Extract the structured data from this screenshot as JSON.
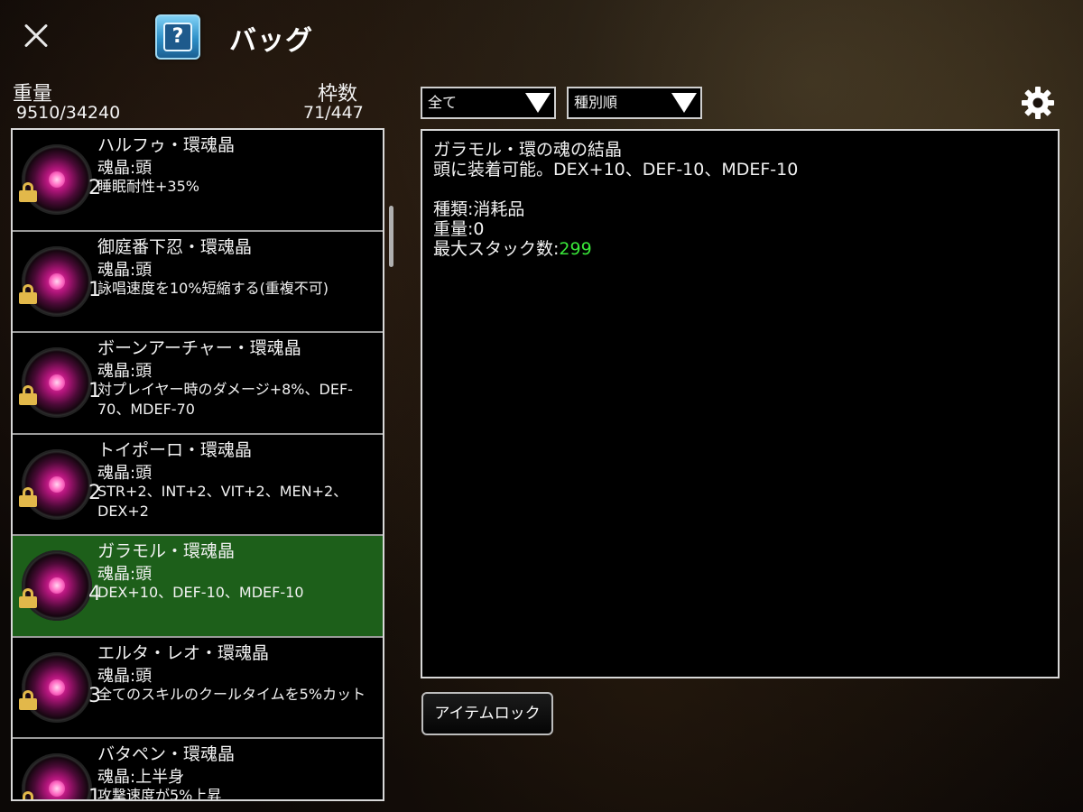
{
  "header": {
    "title": "バッグ",
    "help_glyph": "?",
    "close_icon": "close-icon",
    "settings_icon": "gear-icon"
  },
  "stats": {
    "weight_label": "重量",
    "weight_value": "9510/34240",
    "slots_label": "枠数",
    "slots_value": "71/447"
  },
  "filters": {
    "category": "全て",
    "sort": "種別順"
  },
  "items": [
    {
      "name": "ハルフゥ・環魂晶",
      "slot": "魂晶:頭",
      "qty": "2",
      "effect": "睡眠耐性+35%",
      "locked": true,
      "selected": false
    },
    {
      "name": "御庭番下忍・環魂晶",
      "slot": "魂晶:頭",
      "qty": "1",
      "effect": "詠唱速度を10%短縮する(重複不可)",
      "locked": true,
      "selected": false
    },
    {
      "name": "ボーンアーチャー・環魂晶",
      "slot": "魂晶:頭",
      "qty": "1",
      "effect": "対プレイヤー時のダメージ+8%、DEF-70、MDEF-70",
      "locked": true,
      "selected": false
    },
    {
      "name": "トイポーロ・環魂晶",
      "slot": "魂晶:頭",
      "qty": "2",
      "effect": "STR+2、INT+2、VIT+2、MEN+2、DEX+2",
      "locked": true,
      "selected": false
    },
    {
      "name": "ガラモル・環魂晶",
      "slot": "魂晶:頭",
      "qty": "4",
      "effect": "DEX+10、DEF-10、MDEF-10",
      "locked": true,
      "selected": true
    },
    {
      "name": "エルタ・レオ・環魂晶",
      "slot": "魂晶:頭",
      "qty": "3",
      "effect": "全てのスキルのクールタイムを5%カット",
      "locked": true,
      "selected": false
    },
    {
      "name": "バタペン・環魂晶",
      "slot": "魂晶:上半身",
      "qty": "1",
      "effect": "攻撃速度が5%上昇",
      "locked": true,
      "selected": false
    }
  ],
  "detail": {
    "title": "ガラモル・環の魂の結晶",
    "description": "頭に装着可能。DEX+10、DEF-10、MDEF-10",
    "type_line": "種類:消耗品",
    "weight_line": "重量:0",
    "stack_label": "最大スタック数:",
    "stack_value": "299",
    "stack_color": "#39e639"
  },
  "actions": {
    "item_lock": "アイテムロック"
  },
  "colors": {
    "selected_row": "#1d5f1a",
    "lock_icon": "#e2b84a",
    "orb_glow": "#ff3fb0"
  }
}
